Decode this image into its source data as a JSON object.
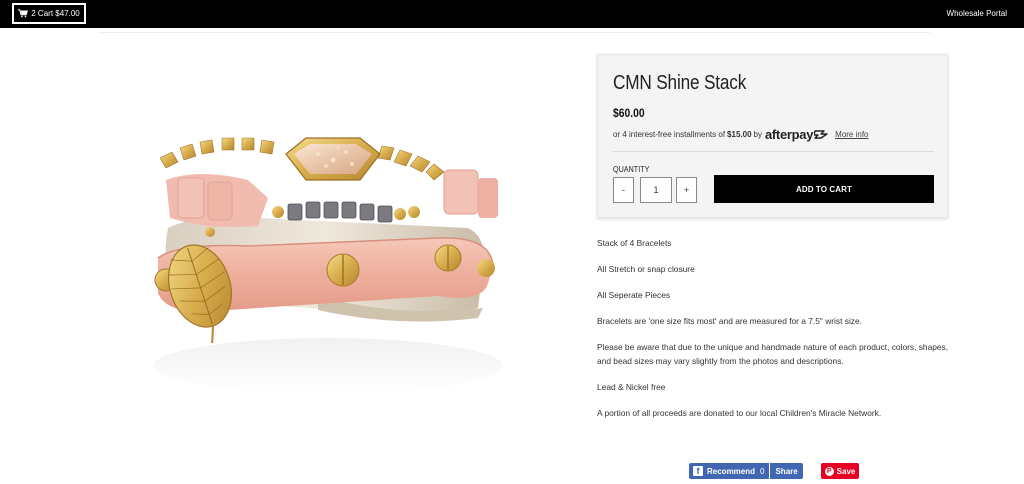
{
  "header": {
    "cart_label": "2 Cart $47.00",
    "wholesale_label": "Wholesale Portal"
  },
  "product": {
    "title": "CMN Shine Stack",
    "price": "$60.00",
    "installments_prefix": "or 4 interest-free installments of",
    "installment_amount": "$15.00",
    "installments_by": "by",
    "afterpay_brand": "afterpay",
    "more_info": "More info",
    "quantity_label": "QUANTITY",
    "quantity_minus": "-",
    "quantity_value": "1",
    "quantity_plus": "+",
    "add_to_cart": "ADD TO CART"
  },
  "description": [
    "Stack of 4 Bracelets",
    "All Stretch or snap closure",
    "All Seperate Pieces",
    "Bracelets are 'one size fits most' and are measured for a 7.5\" wrist size.",
    "Please be aware that due to the unique and handmade nature of each product, colors, shapes, and bead sizes may vary slightly from the photos and descriptions.",
    "Lead & Nickel free",
    "A portion of all proceeds are donated to our local Children's Miracle Network."
  ],
  "social": {
    "fb_recommend": "Recommend",
    "fb_count": "0",
    "fb_share": "Share",
    "pin_save": "Save"
  },
  "colors": {
    "topbar": "#000000",
    "buy_box_bg": "#f4f4f4",
    "add_to_cart_bg": "#000000",
    "facebook": "#4267b2",
    "pinterest": "#e60023",
    "leather_pink": "#f2b8a8",
    "gold": "#d9b45a"
  },
  "icons": {
    "cart": "cart-icon",
    "afterpay": "afterpay-logo-icon",
    "facebook": "facebook-icon",
    "pinterest": "pinterest-icon"
  }
}
